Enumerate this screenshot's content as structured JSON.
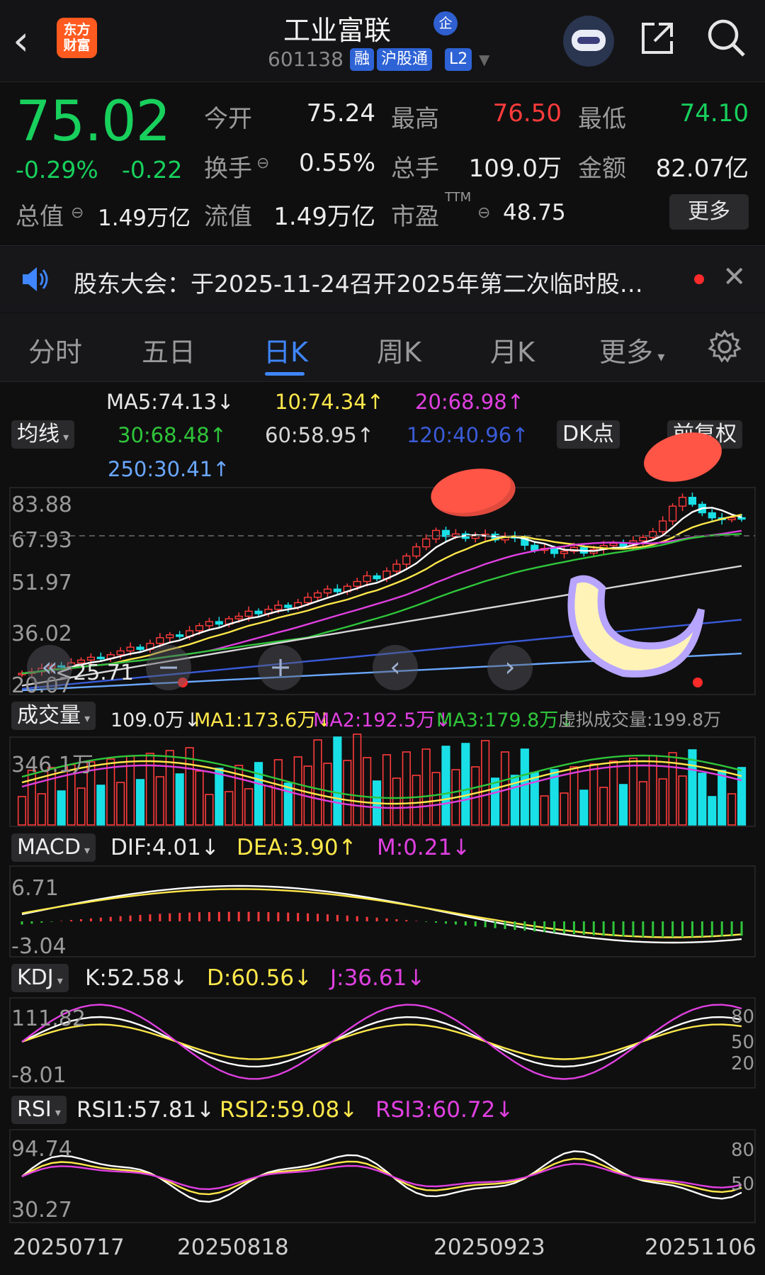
{
  "header": {
    "logo_text": "东方财富",
    "title": "工业富联",
    "qi_badge": "企",
    "code": "601138",
    "tags": [
      "融",
      "沪股通",
      "L2"
    ]
  },
  "quote": {
    "price": "75.02",
    "change_pct": "-0.29%",
    "change": "-0.22",
    "rows": [
      [
        {
          "label": "今开",
          "value": "75.24",
          "color": "#ececec"
        },
        {
          "label": "最高",
          "value": "76.50",
          "color": "#ff3b3b"
        },
        {
          "label": "最低",
          "value": "74.10",
          "color": "#18d05c"
        }
      ],
      [
        {
          "label": "换手",
          "value": "0.55%",
          "color": "#ececec"
        },
        {
          "label": "总手",
          "value": "109.0万",
          "color": "#ececec"
        },
        {
          "label": "金额",
          "value": "82.07亿",
          "color": "#ececec"
        }
      ],
      [
        {
          "label": "流值",
          "value": "1.49万亿",
          "color": "#ececec"
        },
        {
          "label": "市盈",
          "sup": "TTM",
          "value": "48.75",
          "color": "#ececec"
        }
      ]
    ],
    "total_value_label": "总值",
    "total_value": "1.49万亿",
    "more_button": "更多"
  },
  "notice": {
    "text": "股东大会：于2025-11-24召开2025年第二次临时股…"
  },
  "tabs": [
    "分时",
    "五日",
    "日K",
    "周K",
    "月K",
    "更多"
  ],
  "active_tab": "日K",
  "ma_panel": {
    "selector": "均线",
    "dk_button": "DK点",
    "fq_button": "前复权",
    "labels": [
      {
        "text": "MA5:74.13↓",
        "color": "#ffffff"
      },
      {
        "text": "10:74.34↑",
        "color": "#ffe84a"
      },
      {
        "text": "20:68.98↑",
        "color": "#e040e0"
      },
      {
        "text": "30:68.48↑",
        "color": "#2fc53a"
      },
      {
        "text": "60:58.95↑",
        "color": "#d8d8d8"
      },
      {
        "text": "120:40.96↑",
        "color": "#3a5bd8"
      },
      {
        "text": "250:30.41↑",
        "color": "#6aa8ff"
      }
    ]
  },
  "volume_panel": {
    "selector": "成交量",
    "labels": [
      {
        "text": "109.0万↓",
        "color": "#ffffff"
      },
      {
        "text": "MA1:173.6万↓",
        "color": "#ffe84a"
      },
      {
        "text": "MA2:192.5万↓",
        "color": "#e040e0"
      },
      {
        "text": "MA3:179.8万↓",
        "color": "#2fc53a"
      },
      {
        "text": "虚拟成交量:199.8万",
        "color": "#9a9a9a"
      }
    ],
    "axis": "346.1万"
  },
  "macd_panel": {
    "selector": "MACD",
    "labels": [
      {
        "text": "DIF:4.01↓",
        "color": "#ffffff"
      },
      {
        "text": "DEA:3.90↑",
        "color": "#ffe84a"
      },
      {
        "text": "M:0.21↓",
        "color": "#e040e0"
      }
    ],
    "axis_top": "6.71",
    "axis_bottom": "-3.04"
  },
  "kdj_panel": {
    "selector": "KDJ",
    "labels": [
      {
        "text": "K:52.58↓",
        "color": "#ffffff"
      },
      {
        "text": "D:60.56↓",
        "color": "#ffe84a"
      },
      {
        "text": "J:36.61↓",
        "color": "#e040e0"
      }
    ],
    "axis_top": "111.82",
    "axis_bottom": "-8.01",
    "right_ticks": [
      "80",
      "50",
      "20"
    ]
  },
  "rsi_panel": {
    "selector": "RSI",
    "labels": [
      {
        "text": "RSI1:57.81↓",
        "color": "#ffffff"
      },
      {
        "text": "RSI2:59.08↓",
        "color": "#ffe84a"
      },
      {
        "text": "RSI3:60.72↓",
        "color": "#e040e0"
      }
    ],
    "axis_top": "94.74",
    "axis_bottom": "30.27",
    "right_ticks": [
      "80",
      "50"
    ]
  },
  "price_axis": [
    "83.88",
    "67.93",
    "51.97",
    "36.02",
    "20.07"
  ],
  "low_marker": "<25.71",
  "dates": [
    "20250717",
    "20250818",
    "20250923",
    "20251106"
  ],
  "chart_data": {
    "type": "candlestick",
    "x": [
      "20250717",
      "20250818",
      "20250923",
      "20251106"
    ],
    "ylim": [
      20.07,
      83.88
    ],
    "low_marker": 25.71,
    "close_series": [
      25.9,
      26.4,
      27.5,
      28.3,
      28.0,
      29.2,
      30.1,
      31.0,
      30.6,
      31.8,
      33.0,
      34.2,
      33.5,
      35.4,
      37.2,
      38.1,
      37.6,
      39.4,
      41.0,
      42.3,
      41.5,
      43.2,
      44.0,
      45.6,
      44.8,
      46.2,
      47.5,
      46.8,
      48.3,
      50.0,
      51.4,
      52.6,
      51.8,
      53.5,
      55.0,
      56.8,
      55.9,
      58.3,
      60.5,
      63.1,
      66.0,
      68.5,
      71.2,
      69.3,
      70.1,
      68.7,
      69.5,
      70.0,
      68.2,
      69.4,
      68.8,
      66.5,
      64.9,
      65.5,
      63.9,
      64.6,
      65.8,
      64.0,
      65.2,
      66.4,
      67.1,
      66.2,
      67.9,
      69.0,
      70.8,
      74.2,
      78.9,
      81.7,
      79.5,
      76.8,
      75.2,
      74.6,
      75.24,
      75.02
    ]
  }
}
